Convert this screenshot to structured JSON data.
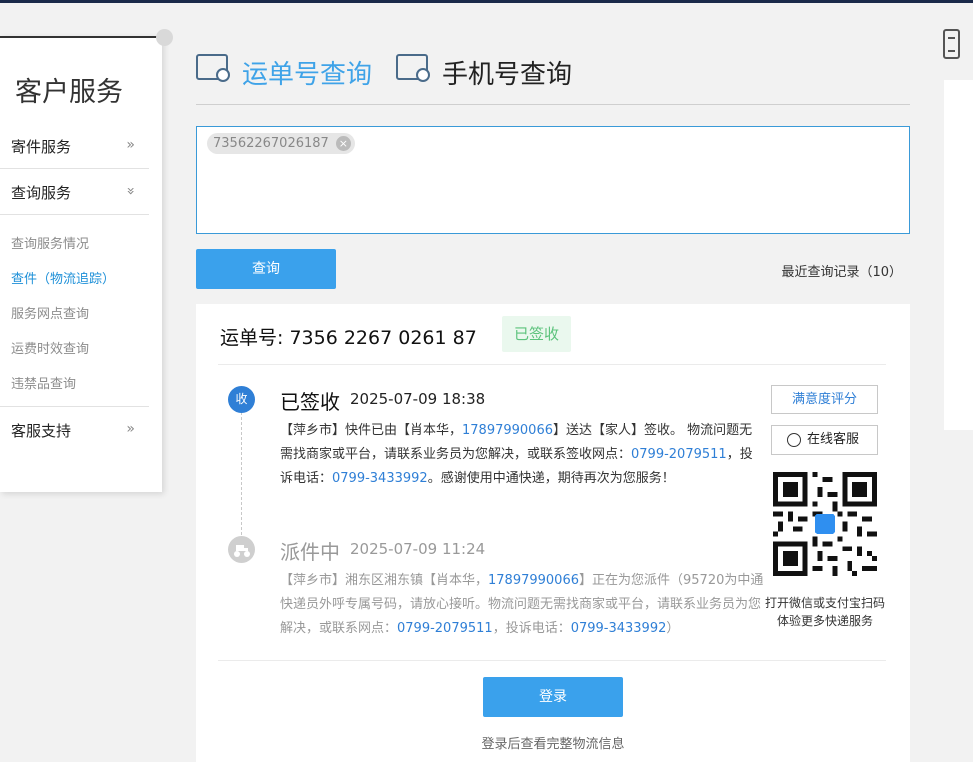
{
  "sidebar": {
    "title": "客户服务",
    "sections": [
      {
        "label": "寄件服务",
        "chevron": "»"
      },
      {
        "label": "查询服务",
        "chevron": "»"
      },
      {
        "label": "客服支持",
        "chevron": "»"
      }
    ],
    "sub_items": [
      {
        "label": "查询服务情况"
      },
      {
        "label": "查件（物流追踪）",
        "active": true
      },
      {
        "label": "服务网点查询"
      },
      {
        "label": "运费时效查询"
      },
      {
        "label": "违禁品查询"
      }
    ]
  },
  "tabs": [
    {
      "label": "运单号查询",
      "icon": "package-search-icon",
      "active": true
    },
    {
      "label": "手机号查询",
      "icon": "package-search-icon",
      "active": false
    }
  ],
  "search": {
    "chip_value": "73562267026187",
    "chip_close": "⊗",
    "query_button": "查询",
    "recent_link": "最近查询记录（10）"
  },
  "result": {
    "waybill_label": "运单号:",
    "waybill_number": "7356 2267 0261 87",
    "status": "已签收",
    "events": [
      {
        "badge": "收",
        "title": "已签收",
        "time": "2025-07-09 18:38",
        "desc_parts": [
          "【萍乡市】快件已由【肖本华，",
          "17897990066",
          "】送达【家人】签收。 物流问题无需找商家或平台，请联系业务员为您解决，或联系签收网点：",
          "0799-2079511",
          "，投诉电话：",
          "0799-3433992",
          "。感谢使用中通快递，期待再次为您服务！"
        ]
      },
      {
        "badge": "⛟",
        "title": "派件中",
        "time": "2025-07-09 11:24",
        "desc_parts": [
          "【萍乡市】湘东区湘东镇【肖本华，",
          "17897990066",
          "】正在为您派件（95720为中通快递员外呼专属号码，请放心接听。物流问题无需找商家或平台，请联系业务员为您解决，或联系网点：",
          "0799-2079511",
          "，投诉电话：",
          "0799-3433992",
          "）"
        ]
      }
    ],
    "rate_button": "满意度评分",
    "cs_button": "在线客服",
    "qr_caption_1": "打开微信或支付宝扫码",
    "qr_caption_2": "体验更多快递服务",
    "login_button": "登录",
    "login_note": "登录后查看完整物流信息"
  },
  "colors": {
    "accent": "#3aa1ec",
    "link": "#2f7fd6",
    "signed_green": "#5cc37c"
  }
}
